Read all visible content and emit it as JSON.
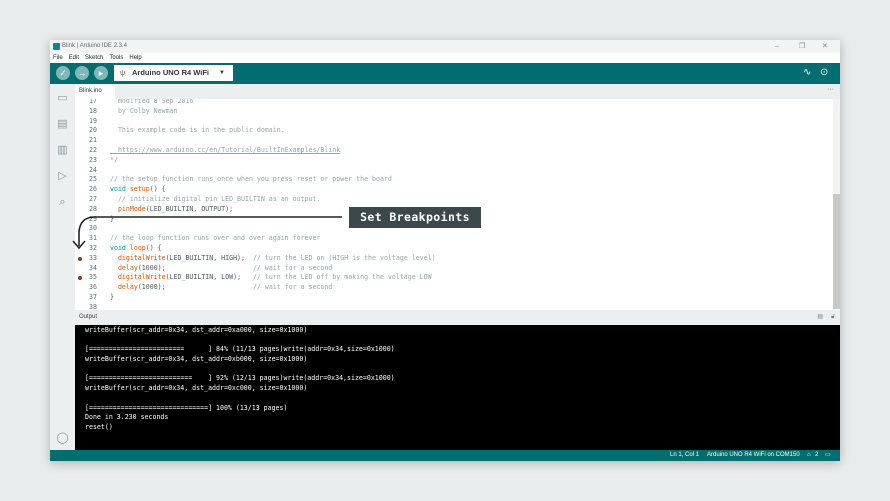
{
  "window": {
    "title": "Blink | Arduino IDE 2.3.4"
  },
  "menu": [
    "File",
    "Edit",
    "Sketch",
    "Tools",
    "Help"
  ],
  "toolbar": {
    "board": "Arduino UNO R4 WiFi"
  },
  "tab": {
    "name": "Blink.ino",
    "more": "···"
  },
  "code": [
    {
      "n": "17",
      "t": "  modified 8 Sep 2016",
      "cls": "c"
    },
    {
      "n": "18",
      "t": "  by Colby Newman",
      "cls": "c"
    },
    {
      "n": "19",
      "t": "",
      "cls": "c"
    },
    {
      "n": "20",
      "t": "  This example code is in the public domain.",
      "cls": "c"
    },
    {
      "n": "21",
      "t": "",
      "cls": "c"
    },
    {
      "n": "22",
      "t": "  https://www.arduino.cc/en/Tutorial/BuiltInExamples/Blink",
      "cls": "u"
    },
    {
      "n": "23",
      "t": "*/",
      "cls": "c"
    },
    {
      "n": "24",
      "t": "",
      "cls": ""
    },
    {
      "n": "25",
      "t": "// the setup function runs once when you press reset or power the board",
      "cls": "c"
    },
    {
      "n": "26",
      "t": "void setup() {",
      "cls": ""
    },
    {
      "n": "27",
      "t": "  // initialize digital pin LED_BUILTIN as an output.",
      "cls": "c"
    },
    {
      "n": "28",
      "t": "  pinMode(LED_BUILTIN, OUTPUT);",
      "cls": ""
    },
    {
      "n": "29",
      "t": "}",
      "cls": ""
    },
    {
      "n": "30",
      "t": "",
      "cls": ""
    },
    {
      "n": "31",
      "t": "// the loop function runs over and over again forever",
      "cls": "c"
    },
    {
      "n": "32",
      "t": "void loop() {",
      "cls": ""
    },
    {
      "n": "33",
      "t": "  digitalWrite(LED_BUILTIN, HIGH);  // turn the LED on (HIGH is the voltage level)",
      "cls": "",
      "bp": true
    },
    {
      "n": "34",
      "t": "  delay(1000);                      // wait for a second",
      "cls": ""
    },
    {
      "n": "35",
      "t": "  digitalWrite(LED_BUILTIN, LOW);   // turn the LED off by making the voltage LOW",
      "cls": "",
      "bp": true
    },
    {
      "n": "36",
      "t": "  delay(1000);                      // wait for a second",
      "cls": ""
    },
    {
      "n": "37",
      "t": "}",
      "cls": ""
    },
    {
      "n": "38",
      "t": "",
      "cls": ""
    }
  ],
  "output": {
    "label": "Output",
    "lines": [
      "writeBuffer(scr_addr=0x34, dst_addr=0xa000, size=0x1000)",
      "",
      "[========================      ] 84% (11/13 pages)write(addr=0x34,size=0x1000)",
      "writeBuffer(scr_addr=0x34, dst_addr=0xb000, size=0x1000)",
      "",
      "[==========================    ] 92% (12/13 pages)write(addr=0x34,size=0x1000)",
      "writeBuffer(scr_addr=0x34, dst_addr=0xc000, size=0x1000)",
      "",
      "[==============================] 100% (13/13 pages)",
      "Done in 3.230 seconds",
      "reset()"
    ]
  },
  "status": {
    "position": "Ln 1, Col 1",
    "board": "Arduino UNO R4 WiFi on COM150",
    "notifications": "2"
  },
  "callout": "Set Breakpoints",
  "colors": {
    "accent": "#006d70",
    "breakpoint": "#8b3a1a"
  }
}
